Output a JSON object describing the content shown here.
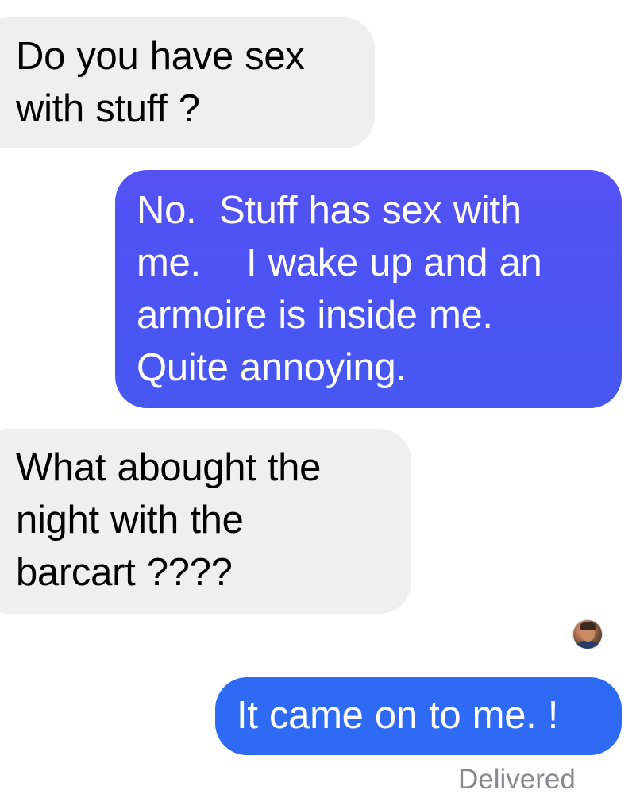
{
  "conversation": {
    "messages": [
      {
        "direction": "incoming",
        "text": "Do you have sex\nwith stuff ?"
      },
      {
        "direction": "outgoing",
        "text": "No.  Stuff has sex with\nme.    I wake up and an\narmoire is inside me.\nQuite annoying."
      },
      {
        "direction": "incoming",
        "text": "What abought the\nnight with the\nbarcart ????"
      },
      {
        "direction": "outgoing",
        "text": "It came on to me. !"
      }
    ],
    "read_receipt_avatar": "contact-avatar",
    "status": "Delivered"
  },
  "colors": {
    "incoming_bubble": "#efefef",
    "outgoing_bubble_top": "#5451f5",
    "outgoing_bubble_bottom": "#4658f1",
    "outgoing_bubble_last": "#2e6af3",
    "status_text": "#8a8a8e"
  }
}
